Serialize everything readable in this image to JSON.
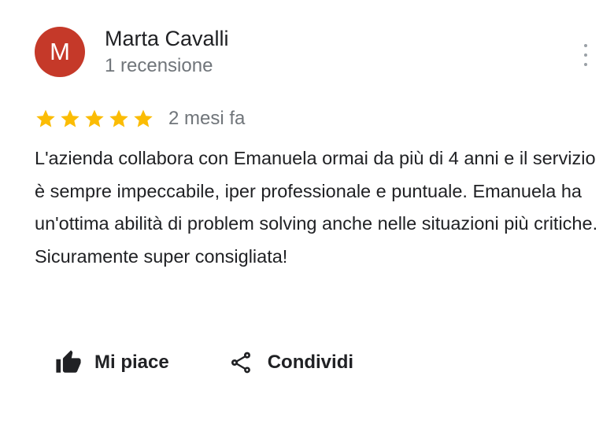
{
  "reviewer": {
    "initial": "M",
    "name": "Marta Cavalli",
    "review_count": "1 recensione"
  },
  "rating": {
    "stars": 5,
    "max": 5,
    "time_ago": "2 mesi fa"
  },
  "review": {
    "text": "L'azienda collabora con Emanuela ormai da più di 4 anni e il servizio è sempre impeccabile, iper professionale e puntuale. Emanuela ha un'ottima abilità di problem solving anche nelle situazioni più critiche. Sicuramente super consigliata!"
  },
  "actions": {
    "like_label": "Mi piace",
    "share_label": "Condividi"
  },
  "icons": {
    "like": "thumb-up-icon",
    "share": "share-icon",
    "more": "more-vert-icon",
    "star": "star-icon"
  },
  "colors": {
    "avatar_bg": "#c53929",
    "star": "#fbbc04",
    "secondary_text": "#70757a",
    "primary_text": "#202124"
  }
}
